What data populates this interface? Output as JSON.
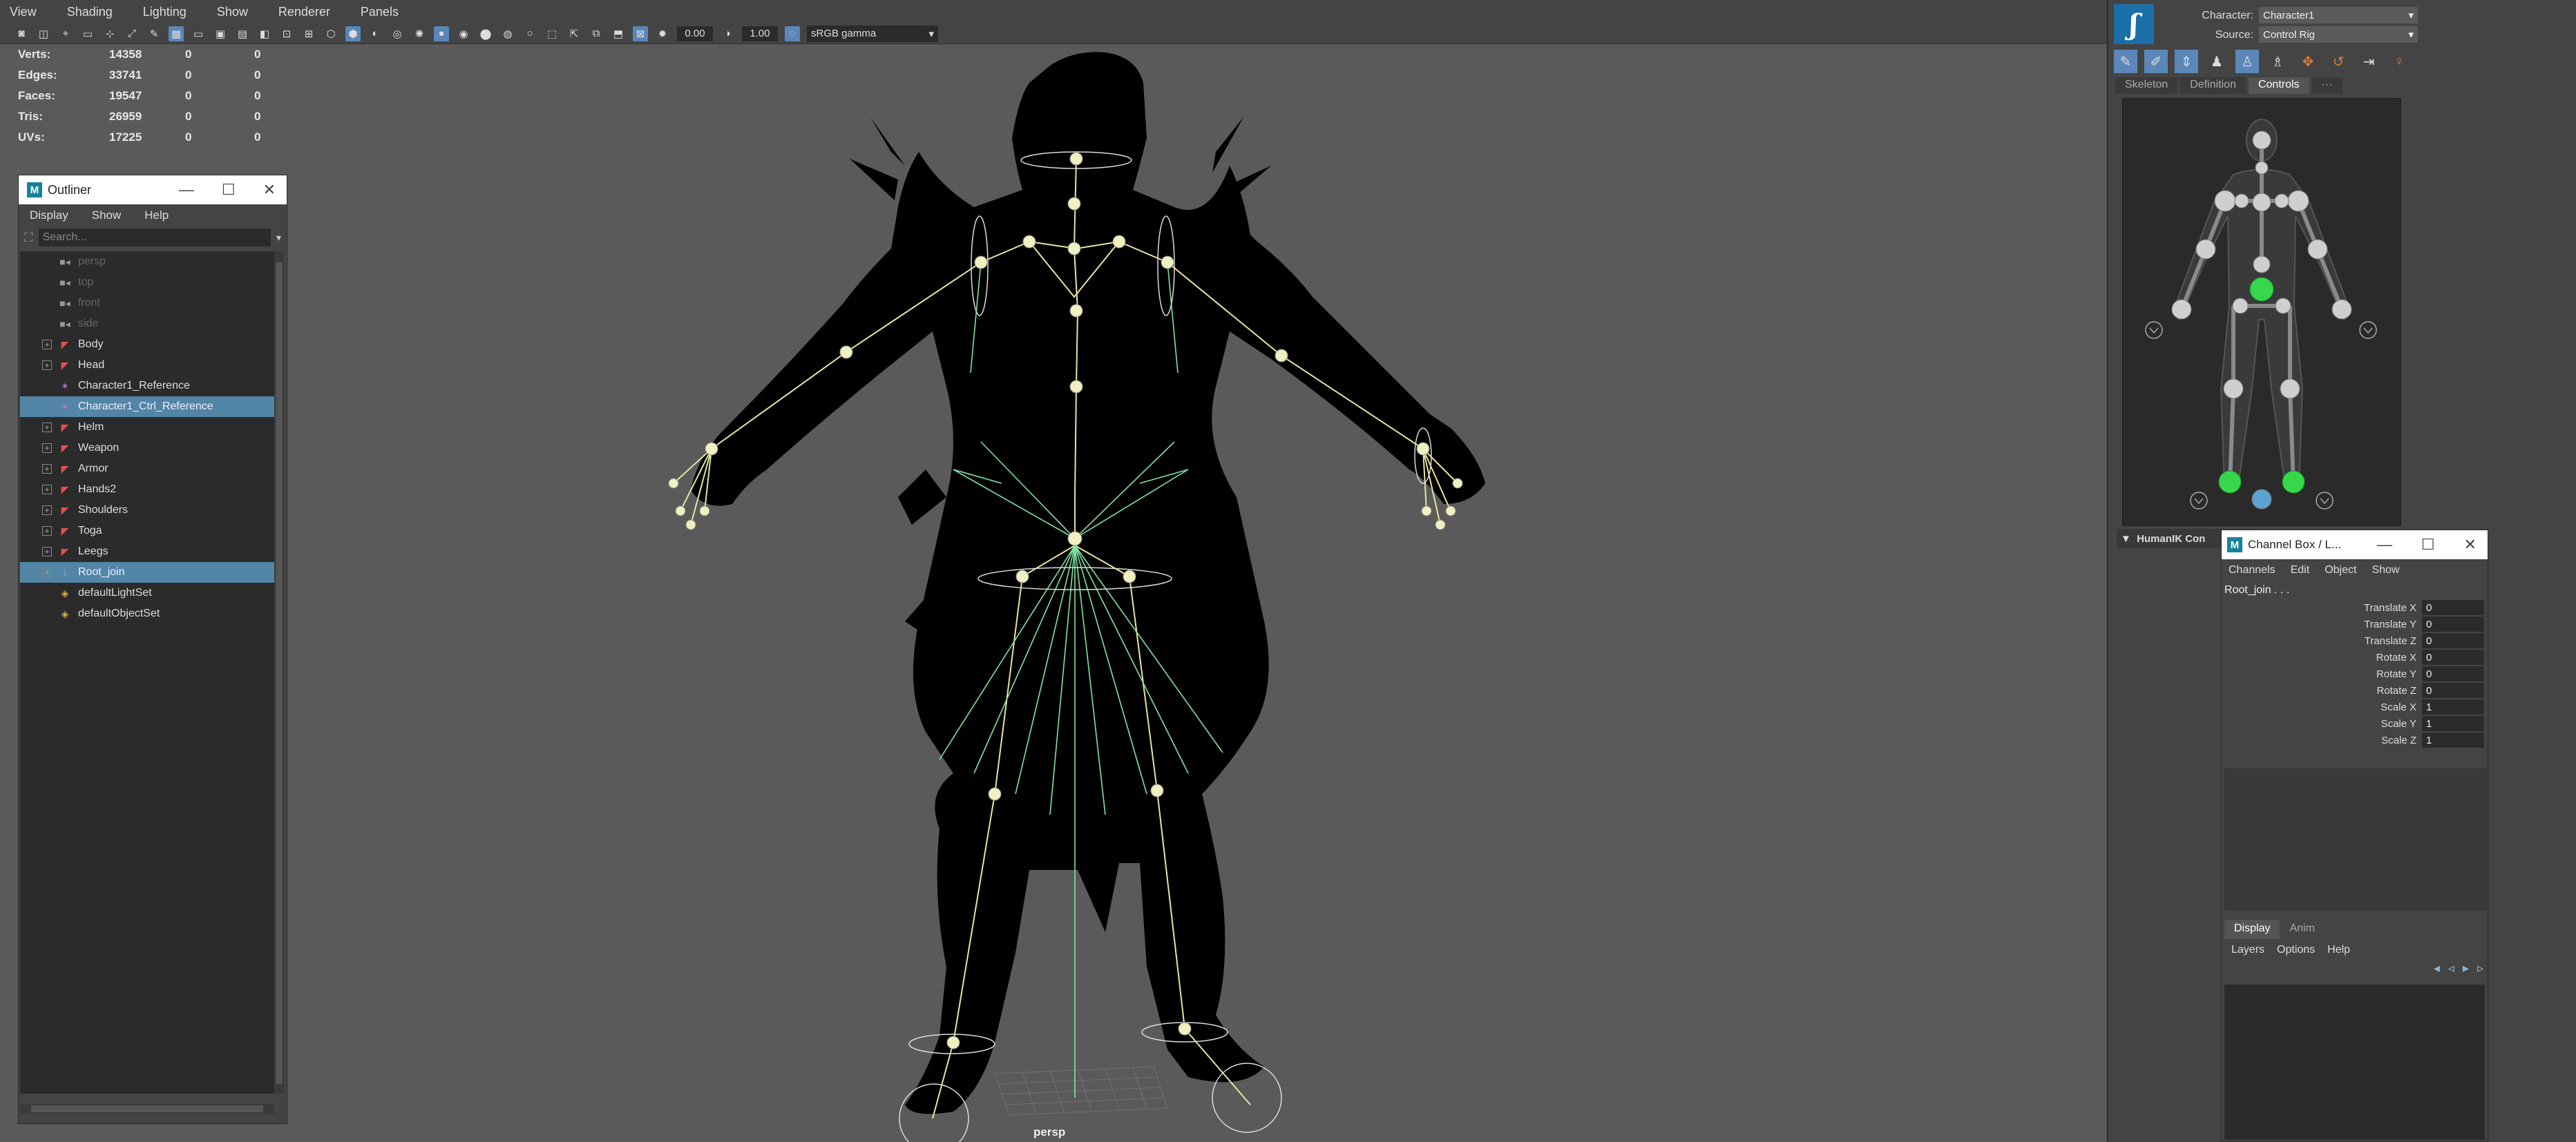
{
  "viewport": {
    "menu": [
      "View",
      "Shading",
      "Lighting",
      "Show",
      "Renderer",
      "Panels"
    ],
    "toolbar": {
      "exposure_value": "0.00",
      "gamma_value": "1.00",
      "color_space": "sRGB gamma"
    },
    "hud": [
      {
        "label": "Verts:",
        "v1": "14358",
        "v2": "0",
        "v3": "0"
      },
      {
        "label": "Edges:",
        "v1": "33741",
        "v2": "0",
        "v3": "0"
      },
      {
        "label": "Faces:",
        "v1": "19547",
        "v2": "0",
        "v3": "0"
      },
      {
        "label": "Tris:",
        "v1": "26959",
        "v2": "0",
        "v3": "0"
      },
      {
        "label": "UVs:",
        "v1": "17225",
        "v2": "0",
        "v3": "0"
      }
    ],
    "camera_label": "persp"
  },
  "outliner": {
    "title": "Outliner",
    "menu": [
      "Display",
      "Show",
      "Help"
    ],
    "search_placeholder": "Search...",
    "items": [
      {
        "label": "persp",
        "icon": "camera-icon",
        "dim": true,
        "expand": false,
        "selected": false
      },
      {
        "label": "top",
        "icon": "camera-icon",
        "dim": true,
        "expand": false,
        "selected": false
      },
      {
        "label": "front",
        "icon": "camera-icon",
        "dim": true,
        "expand": false,
        "selected": false
      },
      {
        "label": "side",
        "icon": "camera-icon",
        "dim": true,
        "expand": false,
        "selected": false
      },
      {
        "label": "Body",
        "icon": "mesh-icon",
        "dim": false,
        "expand": true,
        "selected": false
      },
      {
        "label": "Head",
        "icon": "mesh-icon",
        "dim": false,
        "expand": true,
        "selected": false
      },
      {
        "label": "Character1_Reference",
        "icon": "reference-icon",
        "dim": false,
        "expand": false,
        "selected": false
      },
      {
        "label": "Character1_Ctrl_Reference",
        "icon": "reference-icon",
        "dim": false,
        "expand": false,
        "selected": true
      },
      {
        "label": "Helm",
        "icon": "mesh-icon",
        "dim": false,
        "expand": true,
        "selected": false
      },
      {
        "label": "Weapon",
        "icon": "mesh-icon",
        "dim": false,
        "expand": true,
        "selected": false
      },
      {
        "label": "Armor",
        "icon": "mesh-icon",
        "dim": false,
        "expand": true,
        "selected": false
      },
      {
        "label": "Hands2",
        "icon": "mesh-icon",
        "dim": false,
        "expand": true,
        "selected": false
      },
      {
        "label": "Shoulders",
        "icon": "mesh-icon",
        "dim": false,
        "expand": true,
        "selected": false
      },
      {
        "label": "Toga",
        "icon": "mesh-icon",
        "dim": false,
        "expand": true,
        "selected": false
      },
      {
        "label": "Leegs",
        "icon": "mesh-icon",
        "dim": false,
        "expand": true,
        "selected": false
      },
      {
        "label": "Root_join",
        "icon": "joint-icon",
        "dim": false,
        "expand": true,
        "selected": true
      },
      {
        "label": "defaultLightSet",
        "icon": "set-icon",
        "dim": false,
        "expand": false,
        "selected": false
      },
      {
        "label": "defaultObjectSet",
        "icon": "set-icon",
        "dim": false,
        "expand": false,
        "selected": false
      }
    ]
  },
  "humanik": {
    "character_label": "Character:",
    "character_value": "Character1",
    "source_label": "Source:",
    "source_value": "Control Rig",
    "tabs": [
      "Skeleton",
      "Definition",
      "Controls",
      "···"
    ],
    "active_tab": "Controls",
    "section_label": "HumanIK Con"
  },
  "channel_box": {
    "title": "Channel Box / L...",
    "menu": [
      "Channels",
      "Edit",
      "Object",
      "Show"
    ],
    "object_name": "Root_join . . .",
    "channels": [
      {
        "label": "Translate X",
        "value": "0"
      },
      {
        "label": "Translate Y",
        "value": "0"
      },
      {
        "label": "Translate Z",
        "value": "0"
      },
      {
        "label": "Rotate X",
        "value": "0"
      },
      {
        "label": "Rotate Y",
        "value": "0"
      },
      {
        "label": "Rotate Z",
        "value": "0"
      },
      {
        "label": "Scale X",
        "value": "1"
      },
      {
        "label": "Scale Y",
        "value": "1"
      },
      {
        "label": "Scale Z",
        "value": "1"
      }
    ],
    "layer_tabs": [
      "Display",
      "Anim"
    ],
    "layer_menu": [
      "Layers",
      "Options",
      "Help"
    ]
  },
  "colors": {
    "selection": "#5285a6",
    "accent": "#5a87b8",
    "joint_green": "#7ee6a0",
    "joint_yellow": "#e6e6a0",
    "hik_effector_green": "#35d84a"
  }
}
